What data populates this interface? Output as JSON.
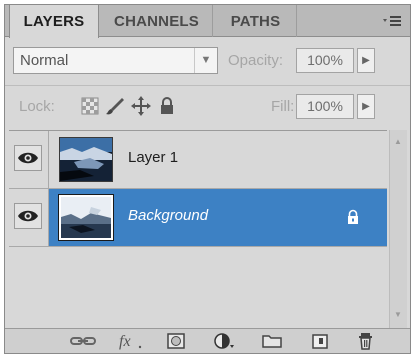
{
  "tabs": [
    {
      "label": "LAYERS",
      "active": true
    },
    {
      "label": "CHANNELS",
      "active": false
    },
    {
      "label": "PATHS",
      "active": false
    }
  ],
  "panel_menu_icon": "panel-menu-icon",
  "blend_mode": {
    "value": "Normal"
  },
  "opacity": {
    "label": "Opacity:",
    "value": "100%"
  },
  "lock": {
    "label": "Lock:",
    "icons": [
      "lock-transparent-icon",
      "lock-image-icon",
      "lock-position-icon",
      "lock-all-icon"
    ]
  },
  "fill": {
    "label": "Fill:",
    "value": "100%"
  },
  "layers": [
    {
      "name": "Layer 1",
      "visible": true,
      "selected": false,
      "locked": false
    },
    {
      "name": "Background",
      "visible": true,
      "selected": true,
      "locked": true
    }
  ],
  "bottom_toolbar": [
    "link-layers-icon",
    "fx-icon",
    "add-mask-icon",
    "adjustment-layer-icon",
    "new-group-icon",
    "new-layer-icon",
    "trash-icon"
  ],
  "colors": {
    "selected_row": "#3d81c4",
    "panel_bg": "#d8d8d8",
    "tabbar_bg": "#b9b9b9"
  }
}
